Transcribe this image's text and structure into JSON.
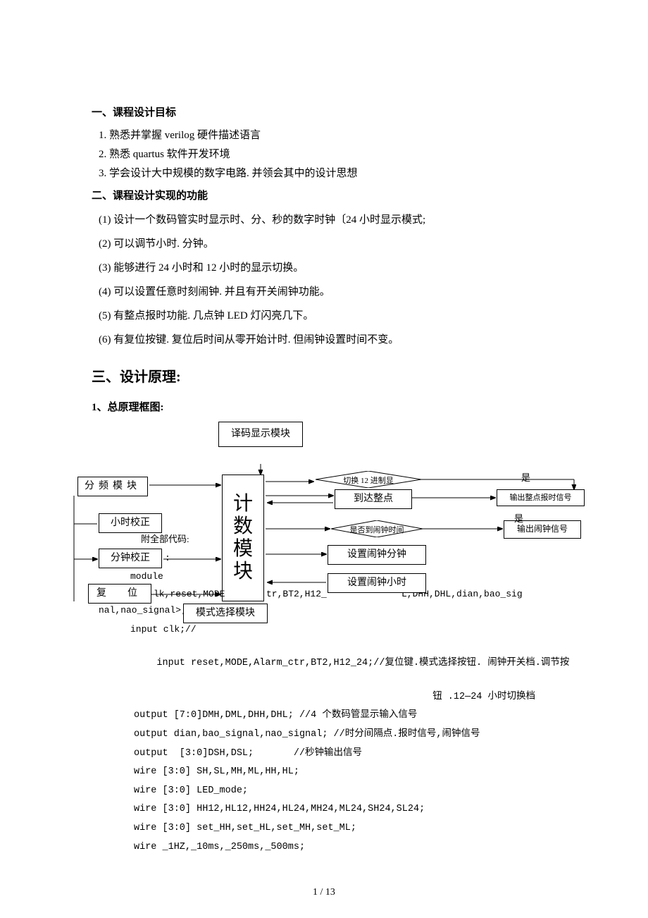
{
  "heading1": "一、课程设计目标",
  "goals": {
    "n1": "1.",
    "t1": "熟悉并掌握 verilog 硬件描述语言",
    "n2": "2.",
    "t2": "熟悉 quartus 软件开发环境",
    "n3": "3.",
    "t3": "学会设计大中规模的数字电路. 并领会其中的设计思想"
  },
  "heading2": "二、课程设计实现的功能",
  "func": {
    "f1": "(1) 设计一个数码管实时显示时、分、秒的数字时钟〔24 小时显示模式;",
    "f2": "(2) 可以调节小时. 分钟。",
    "f3": "(3) 能够进行 24 小时和 12 小时的显示切换。",
    "f4": "(4) 可以设置任意时刻闹钟. 并且有开关闹钟功能。",
    "f5": "(5) 有整点报时功能. 几点钟 LED 灯闪亮几下。",
    "f6": "(6) 有复位按键. 复位后时间从零开始计时. 但闹钟设置时间不变。"
  },
  "heading3": "三、设计原理:",
  "sub1": "1、总原理框图:",
  "diagram": {
    "decode": "译码显示模块",
    "freq": "分频模块",
    "counter": "计数模块",
    "hour_adj": "小时校正",
    "min_adj": "分钟校正",
    "reset": "复　位",
    "mode_sel": "模式选择模块",
    "switch12": "切换 12 进制显",
    "reach_hour": "到达整点",
    "is_alarm": "是否到闹钟时间",
    "set_alarm_min": "设置闹钟分钟",
    "set_alarm_hour": "设置闹钟小时",
    "out_hour": "输出整点报时信号",
    "out_alarm": "输出闹钟信号",
    "yes1": "是",
    "yes2": "是",
    "hidden1": "附全部代码:",
    "hidden2": ":",
    "hidden3": "module",
    "hidden4": "lk,reset,MODE",
    "hidden5": "tr,BT2,H12_",
    "hidden6": "L,DHH,DHL,dian,bao_sig",
    "hidden7": "nal,nao_signal>;",
    "hidden8": "input clk;//"
  },
  "code": {
    "l1": "input reset,MODE,Alarm_ctr,BT2,H12_24;//复位键.模式选择按钮. 闹钟开关档.调节按",
    "l1b": "钮 .12—24 小时切换档",
    "l2": "output [7:0]DMH,DML,DHH,DHL; //4 个数码管显示输入信号",
    "l3": "output dian,bao_signal,nao_signal; //时分间隔点.报时信号,闹钟信号",
    "l4": "output  [3:0]DSH,DSL;       //秒钟输出信号",
    "l5": "wire [3:0] SH,SL,MH,ML,HH,HL;",
    "l6": "wire [3:0] LED_mode;",
    "l7": "wire [3:0] HH12,HL12,HH24,HL24,MH24,ML24,SH24,SL24;",
    "l8": "wire [3:0] set_HH,set_HL,set_MH,set_ML;",
    "l9": "wire _1HZ,_10ms,_250ms,_500ms;"
  },
  "page_num": "1 / 13"
}
